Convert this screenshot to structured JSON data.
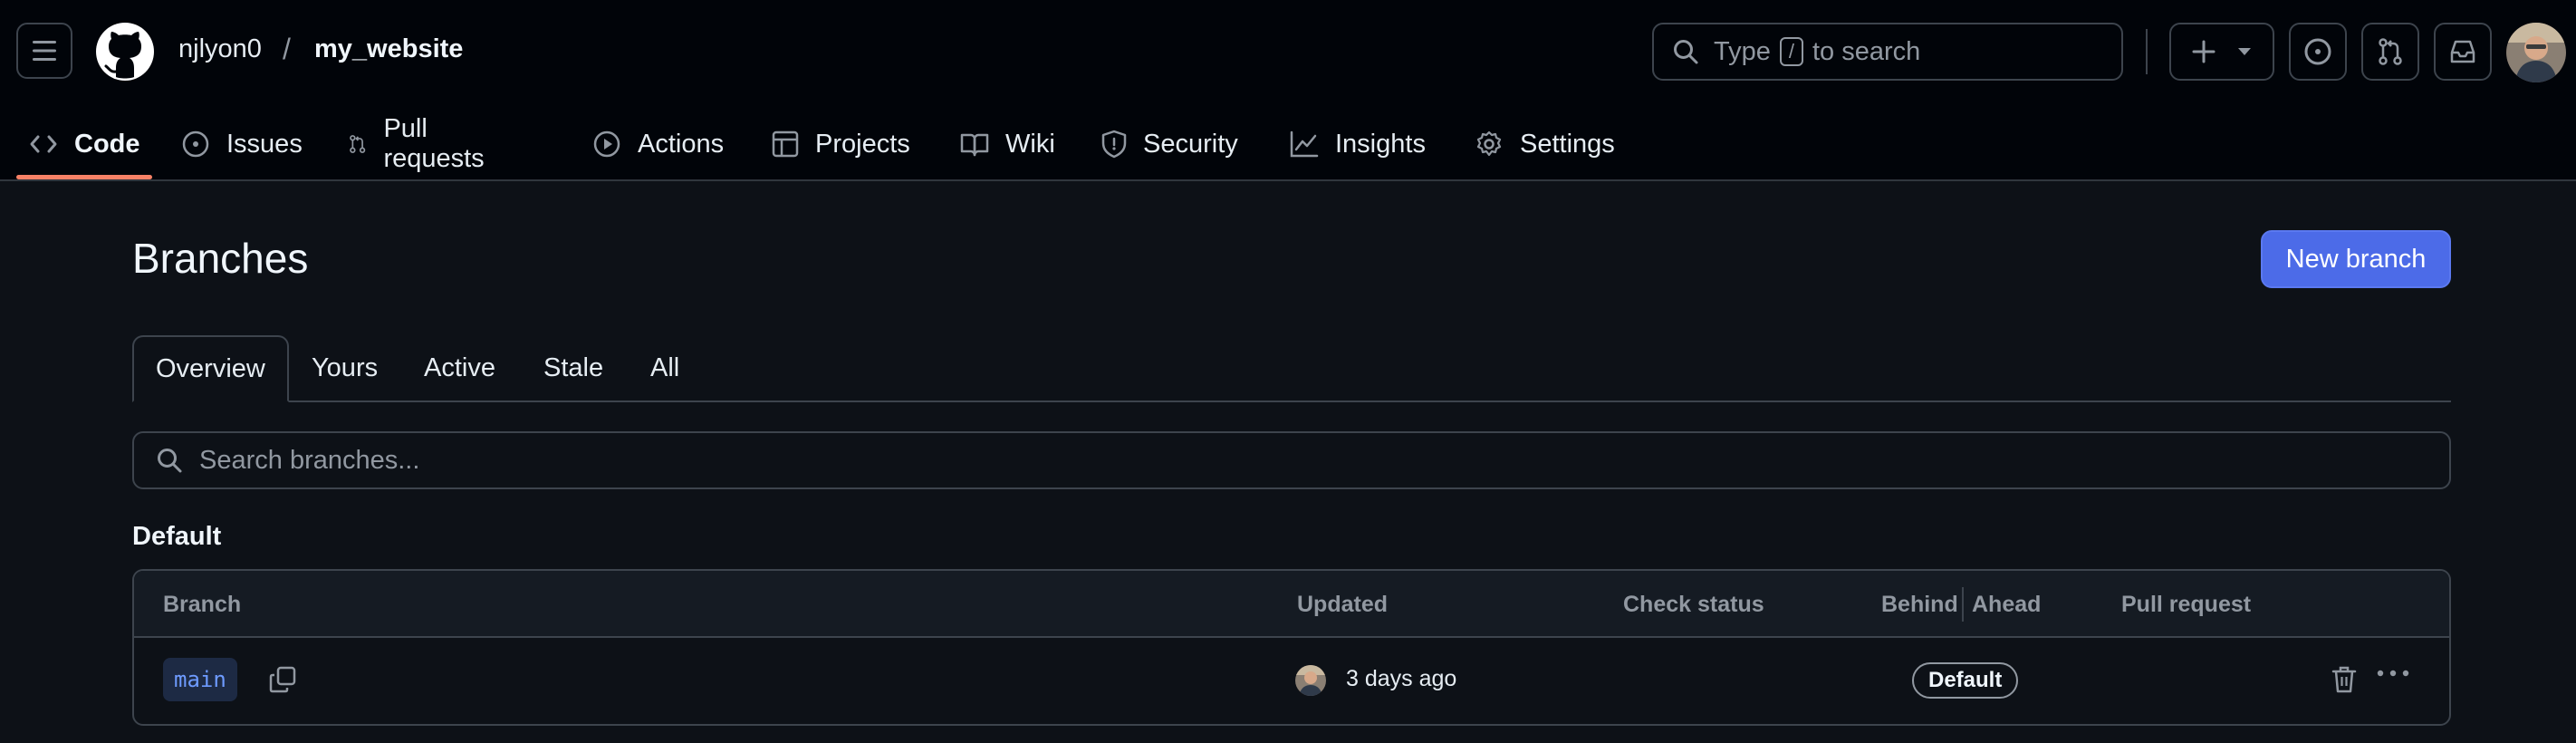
{
  "header": {
    "owner": "njlyon0",
    "separator": "/",
    "repo": "my_website",
    "search": {
      "prefix": "Type",
      "key": "/",
      "suffix": "to search"
    },
    "create_icon": "plus-icon",
    "dropdown_icon": "triangle-down-icon"
  },
  "nav": {
    "tabs": [
      {
        "label": "Code",
        "icon": "code-icon",
        "selected": true
      },
      {
        "label": "Issues",
        "icon": "issue-opened-icon"
      },
      {
        "label": "Pull requests",
        "icon": "git-pull-request-icon"
      },
      {
        "label": "Actions",
        "icon": "play-icon"
      },
      {
        "label": "Projects",
        "icon": "table-icon"
      },
      {
        "label": "Wiki",
        "icon": "book-icon"
      },
      {
        "label": "Security",
        "icon": "shield-icon"
      },
      {
        "label": "Insights",
        "icon": "graph-icon"
      },
      {
        "label": "Settings",
        "icon": "gear-icon"
      }
    ]
  },
  "page": {
    "title": "Branches",
    "new_branch_label": "New branch",
    "subtabs": [
      "Overview",
      "Yours",
      "Active",
      "Stale",
      "All"
    ],
    "selected_subtab": "Overview",
    "search_placeholder": "Search branches...",
    "section": "Default"
  },
  "table": {
    "headers": {
      "branch": "Branch",
      "updated": "Updated",
      "check_status": "Check status",
      "behind": "Behind",
      "ahead": "Ahead",
      "pull_request": "Pull request"
    },
    "rows": [
      {
        "branch": "main",
        "updated": "3 days ago",
        "badge": "Default"
      }
    ]
  },
  "colors": {
    "background": "#0d1117",
    "header_bg": "#010409",
    "accent_underline": "#f78166",
    "primary_button": "#4c6be8",
    "branch_text": "#6e9bff"
  }
}
